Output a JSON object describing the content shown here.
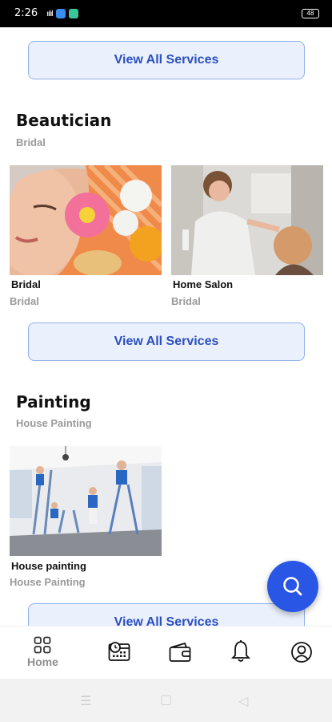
{
  "status_bar": {
    "time": "2:26",
    "signal": "ıılıl",
    "battery": "48"
  },
  "buttons": {
    "view_all_label": "View All Services"
  },
  "sections": [
    {
      "title": "Beautician",
      "subtitle": "Bridal",
      "cards": [
        {
          "name": "Bridal",
          "sub": "Bridal"
        },
        {
          "name": "Home Salon",
          "sub": "Bridal"
        }
      ]
    },
    {
      "title": "Painting",
      "subtitle": "House Painting",
      "cards": [
        {
          "name": "House painting",
          "sub": "House Painting"
        }
      ]
    }
  ],
  "bottom_nav": {
    "items": [
      {
        "label": "Home",
        "icon": "grid-icon"
      },
      {
        "label": "",
        "icon": "calendar-icon"
      },
      {
        "label": "",
        "icon": "wallet-icon"
      },
      {
        "label": "",
        "icon": "bell-icon"
      },
      {
        "label": "",
        "icon": "profile-icon"
      }
    ]
  },
  "colors": {
    "accent": "#2a56e6",
    "button_bg": "#eaf1fd",
    "button_text": "#2c4fbe",
    "muted": "#9a9a9a"
  }
}
